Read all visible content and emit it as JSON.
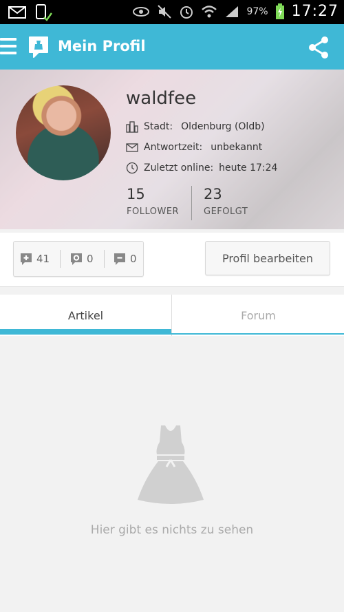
{
  "status_bar": {
    "battery_percent": "97%",
    "time": "17:27",
    "icons": [
      "mail-icon",
      "phone-check-icon",
      "eye-icon",
      "mute-icon",
      "alarm-icon",
      "wifi-icon",
      "signal-icon",
      "battery-icon"
    ]
  },
  "app_bar": {
    "title": "Mein Profil",
    "accent_color": "#3fb8d6",
    "icons": [
      "menu-icon",
      "app-logo-icon",
      "share-icon"
    ]
  },
  "profile": {
    "username": "waldfee",
    "city_label": "Stadt:",
    "city_value": "Oldenburg (Oldb)",
    "response_label": "Antwortzeit:",
    "response_value": "unbekannt",
    "online_label": "Zuletzt online:",
    "online_value": "heute 17:24",
    "follower_count": "15",
    "follower_label": "FOLLOWER",
    "following_count": "23",
    "following_label": "GEFOLGT"
  },
  "actions": {
    "plus_count": "41",
    "circle_count": "0",
    "minus_count": "0",
    "edit_button": "Profil bearbeiten"
  },
  "tabs": [
    {
      "label": "Artikel",
      "active": true
    },
    {
      "label": "Forum",
      "active": false
    }
  ],
  "empty_state": {
    "text": "Hier gibt es nichts zu sehen"
  }
}
